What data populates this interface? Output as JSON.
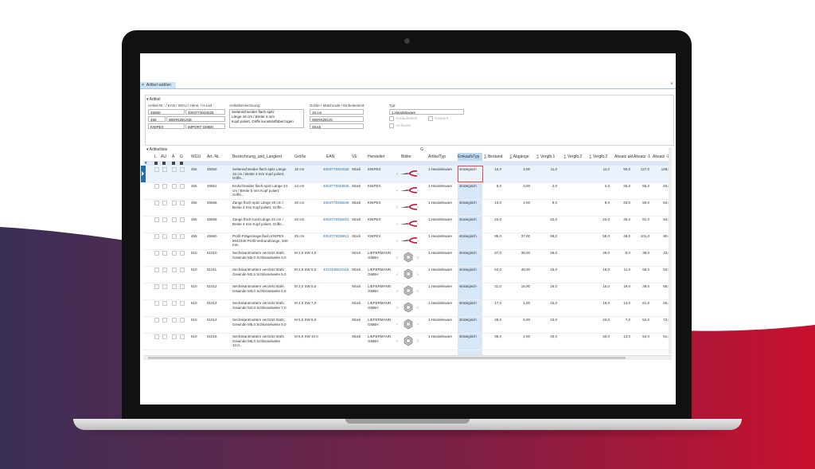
{
  "colors": {
    "accent": "#1e6db6",
    "wave_left": "#3b2f56",
    "wave_right": "#c8102e",
    "highlight": "#bcd9f2"
  },
  "window": {
    "tab_title": "Artikel wählen",
    "close_glyph": "×"
  },
  "artikel": {
    "section_title": "Artikel",
    "nr_label": "Artikel-Nr.: / EAN / WGU / Herst. / H-Lief.:",
    "nr": "45550",
    "ean": "4003773034025",
    "wgu": "455",
    "wgu_name": "WERKZEUGE",
    "hersteller": "KNIPEX",
    "lieferant": "IMPORT GMBH",
    "bez_label": "Artikelbezeichnung:",
    "bez_lines": [
      "Seitenschneider flach-spitz",
      "Länge 16 cm / Breite 4 mm",
      "Kopf poliert, Griffe kunststoffüberzogen"
    ],
    "groesse_label": "Größe / Matchcode / Einheitentext:",
    "groesse": "16 cm",
    "matchcode": "WERKZEUG",
    "einheit": "Stück",
    "typ_label": "Typ:",
    "typ": "1.Handelsware",
    "auslauf": "Auslaufartikel",
    "gesperrt": "Gesperrt",
    "archiviert": "Archiviert"
  },
  "list": {
    "title": "Artikelliste",
    "group_marker": "G",
    "headers": {
      "l": "L",
      "au": "AU",
      "a": "A",
      "g": "G",
      "wgu": "WGU",
      "art": "Art.-Nr.",
      "bez": "Bezeichnung_und_Langtext",
      "groesse": "Größe",
      "ean": "EAN",
      "ve": "VE",
      "hersteller": "Hersteller",
      "bilder": "Bilder",
      "artikeltyp": "ArtikelTyp",
      "einkaufstyp": "EinkaufsTyp",
      "bestand": "∑ Bestand",
      "abgaenge": "∑ Abgänge",
      "vergl1": "∑ Verglb.1",
      "vergl2": "∑ Verglb.2",
      "vergl3": "∑ Verglb.2",
      "absatzakt": "Absatz akt",
      "absatz1": "Absatz -1",
      "absatz2": "Absatz -2"
    },
    "rows": [
      {
        "wgu": "455",
        "art": "45550",
        "bez": "Seitenschneider flach-spitz Länge 16 cm / Breite 4 mm Kopf poliert, Griffe...",
        "groesse": "16 cm",
        "ean": "4003773034025",
        "ve": "Stück",
        "hersteller": "KNIPEX",
        "bild": "pliers",
        "typ": "1.Handelsware",
        "einkauf": "strategisch",
        "bestand": "15,0",
        "abgaenge": "4,00",
        "v1": "11,0",
        "v2": "",
        "v3": "11,0",
        "absakt": "90,0",
        "abs1": "127,0",
        "abs2": "128,0"
      },
      {
        "wgu": "455",
        "art": "45551",
        "bez": "Endschneider flach-spitz Länge 24 cm / Breite 5 mm Kopf poliert, Griffe...",
        "groesse": "24 cm",
        "ean": "4003773043935",
        "ve": "Stück",
        "hersteller": "KNIPEX",
        "bild": "pliers",
        "typ": "1.Handelsware",
        "einkauf": "strategisch",
        "bestand": "5,0",
        "abgaenge": "3,00",
        "v1": "2,0",
        "v2": "",
        "v3": "2,0",
        "absakt": "25,0",
        "abs1": "85,0",
        "abs2": "83,0"
      },
      {
        "wgu": "455",
        "art": "45556",
        "bez": "Zange flach-spitz Länge 20 cm / Breite 4 mm Kopf poliert, Griffe...",
        "groesse": "20 cm",
        "ean": "4003773035046",
        "ve": "Stück",
        "hersteller": "KNIPEX",
        "bild": "pliers",
        "typ": "1.Handelsware",
        "einkauf": "strategisch",
        "bestand": "13,0",
        "abgaenge": "4,00",
        "v1": "9,0",
        "v2": "",
        "v3": "9,0",
        "absakt": "33,0",
        "abs1": "90,0",
        "abs2": "84,0"
      },
      {
        "wgu": "455",
        "art": "45559",
        "bez": "Zange flach-rund Länge 22 cm / Breite 4 mm Kopf poliert, Griffe...",
        "groesse": "20 cm",
        "ean": "4003773035022",
        "ve": "Stück",
        "hersteller": "KNIPEX",
        "bild": "pliers",
        "typ": "1.Handelsware",
        "einkauf": "strategisch",
        "bestand": "22,0",
        "abgaenge": "",
        "v1": "22,0",
        "v2": "",
        "v3": "22,0",
        "absakt": "45,0",
        "abs1": "81,0",
        "abs2": "94,0"
      },
      {
        "wgu": "455",
        "art": "45560",
        "bez": "Profil-Prägezange flach KNIPEX 9042340 Profil-Verbundzange, 340 mm",
        "groesse": "25 cm",
        "ean": "4003773035812",
        "ve": "Stück",
        "hersteller": "KNIPEX",
        "bild": "pliers",
        "typ": "1.Handelsware",
        "einkauf": "strategisch",
        "bestand": "95,0",
        "abgaenge": "37,00",
        "v1": "58,0",
        "v2": "",
        "v3": "58,0",
        "absakt": "46,0",
        "abs1": "101,0",
        "abs2": "90,0"
      },
      {
        "wgu": "510",
        "art": "51010",
        "bez": "Sechskantmuttern verzinkt Stahl, Gewinde M2,0 Schlüsselweite 4,0",
        "groesse": "M 2,0 SW 4,0",
        "ean": "",
        "ve": "Stück",
        "hersteller": "LIEFERMANN GMBH",
        "bild": "nut",
        "typ": "1.Handelsware",
        "einkauf": "strategisch",
        "bestand": "87,0",
        "abgaenge": "38,00",
        "v1": "49,0",
        "v2": "",
        "v3": "49,0",
        "absakt": "5,0",
        "abs1": "38,0",
        "abs2": "43,0"
      },
      {
        "wgu": "510",
        "art": "51011",
        "bez": "Sechskantmuttern verzinkt Stahl, Gewinde M2,5 Schlüsselweite 5,0",
        "groesse": "M 2,5 SW 5,0",
        "ean": "4012345610119",
        "ve": "Stück",
        "hersteller": "LIEFERMANN GMBH",
        "bild": "nut",
        "typ": "1.Handelsware",
        "einkauf": "strategisch",
        "bestand": "64,0",
        "abgaenge": "48,00",
        "v1": "16,0",
        "v2": "",
        "v3": "16,0",
        "absakt": "11,0",
        "abs1": "56,0",
        "abs2": "53,0"
      },
      {
        "wgu": "510",
        "art": "51012",
        "bez": "Sechskantmuttern verzinkt Stahl, Gewinde M3,0 Schlüsselweite 5,5",
        "groesse": "M 3,0 SW 5,5",
        "ean": "",
        "ve": "Stück",
        "hersteller": "LIEFERMANN GMBH",
        "bild": "nut",
        "typ": "1.Handelsware",
        "einkauf": "strategisch",
        "bestand": "31,0",
        "abgaenge": "15,00",
        "v1": "16,0",
        "v2": "",
        "v3": "16,0",
        "absakt": "19,0",
        "abs1": "39,0",
        "abs2": "68,0"
      },
      {
        "wgu": "510",
        "art": "51013",
        "bez": "Sechskantmuttern verzinkt Stahl, Gewinde M4,0 Schlüsselweite 7,0",
        "groesse": "M 4,0 SW 7,0",
        "ean": "",
        "ve": "Stück",
        "hersteller": "LIEFERMANN GMBH",
        "bild": "nut",
        "typ": "1.Handelsware",
        "einkauf": "strategisch",
        "bestand": "17,0",
        "abgaenge": "1,00",
        "v1": "16,0",
        "v2": "",
        "v3": "16,0",
        "absakt": "13,0",
        "abs1": "61,0",
        "abs2": "55,0"
      },
      {
        "wgu": "510",
        "art": "51014",
        "bez": "Sechskantmuttern verzinkt Stahl, Gewinde M5,0 Schlüsselweite 8,0",
        "groesse": "M 5,0 SW 8,0",
        "ean": "",
        "ve": "Stück",
        "hersteller": "LIEFERMANN GMBH",
        "bild": "nut",
        "typ": "1.Handelsware",
        "einkauf": "strategisch",
        "bestand": "28,0",
        "abgaenge": "5,00",
        "v1": "23,0",
        "v2": "",
        "v3": "23,0",
        "absakt": "7,0",
        "abs1": "52,0",
        "abs2": "72,0"
      },
      {
        "wgu": "510",
        "art": "51015",
        "bez": "Sechskantmuttern verzinkt Stahl, Gewinde M6,0 Schlüsselweite 10,0...",
        "groesse": "M 6,0 SW 10,0",
        "ean": "",
        "ve": "Stück",
        "hersteller": "LIEFERMANN GMBH",
        "bild": "nut",
        "typ": "1.Handelsware",
        "einkauf": "strategisch",
        "bestand": "35,0",
        "abgaenge": "2,00",
        "v1": "33,0",
        "v2": "",
        "v3": "33,0",
        "absakt": "13,0",
        "abs1": "54,0",
        "abs2": "51,0"
      }
    ]
  }
}
